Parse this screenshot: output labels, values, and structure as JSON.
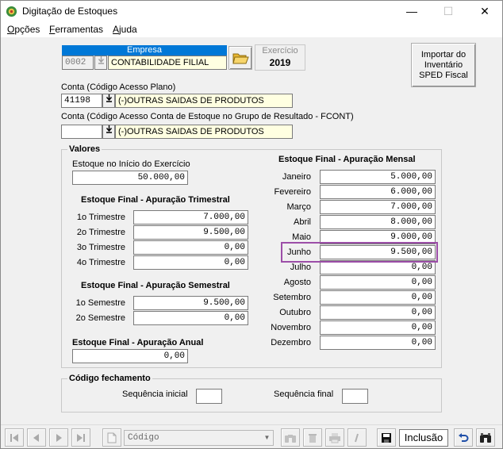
{
  "window": {
    "title": "Digitação de Estoques",
    "minimize": "—",
    "maximize": "☐",
    "close": "✕"
  },
  "menu": {
    "items": [
      {
        "prefix": "",
        "ul": "O",
        "rest": "pções"
      },
      {
        "prefix": "",
        "ul": "F",
        "rest": "erramentas"
      },
      {
        "prefix": "",
        "ul": "A",
        "rest": "juda"
      }
    ]
  },
  "empresa": {
    "header": "Empresa",
    "code": "0002",
    "name": "CONTABILIDADE FILIAL",
    "exercicio_label": "Exercício",
    "exercicio_value": "2019"
  },
  "importar_button": "Importar do Inventário SPED Fiscal",
  "conta": {
    "label": "Conta (Código Acesso Plano)",
    "code": "41198",
    "name": "(-)OUTRAS SAIDAS DE PRODUTOS"
  },
  "conta_fcont": {
    "label": "Conta (Código Acesso Conta de Estoque no Grupo de Resultado - FCONT)",
    "code": "",
    "name": "(-)OUTRAS SAIDAS DE PRODUTOS"
  },
  "valores": {
    "title": "Valores",
    "inicio_label": "Estoque no Início do Exercício",
    "inicio_value": "50.000,00",
    "trimestral": {
      "title": "Estoque Final - Apuração Trimestral",
      "rows": [
        {
          "label": "1o Trimestre",
          "value": "7.000,00"
        },
        {
          "label": "2o Trimestre",
          "value": "9.500,00"
        },
        {
          "label": "3o Trimestre",
          "value": "0,00"
        },
        {
          "label": "4o Trimestre",
          "value": "0,00"
        }
      ]
    },
    "semestral": {
      "title": "Estoque Final - Apuração Semestral",
      "rows": [
        {
          "label": "1o Semestre",
          "value": "9.500,00"
        },
        {
          "label": "2o Semestre",
          "value": "0,00"
        }
      ]
    },
    "anual": {
      "title": "Estoque Final - Apuração Anual",
      "value": "0,00"
    },
    "mensal": {
      "title": "Estoque Final - Apuração Mensal",
      "rows": [
        {
          "label": "Janeiro",
          "value": "5.000,00"
        },
        {
          "label": "Fevereiro",
          "value": "6.000,00"
        },
        {
          "label": "Março",
          "value": "7.000,00"
        },
        {
          "label": "Abril",
          "value": "8.000,00"
        },
        {
          "label": "Maio",
          "value": "9.000,00"
        },
        {
          "label": "Junho",
          "value": "9.500,00"
        },
        {
          "label": "Julho",
          "value": "0,00"
        },
        {
          "label": "Agosto",
          "value": "0,00"
        },
        {
          "label": "Setembro",
          "value": "0,00"
        },
        {
          "label": "Outubro",
          "value": "0,00"
        },
        {
          "label": "Novembro",
          "value": "0,00"
        },
        {
          "label": "Dezembro",
          "value": "0,00"
        }
      ]
    }
  },
  "fechamento": {
    "title": "Código fechamento",
    "seq_inicial_label": "Sequência inicial",
    "seq_inicial_value": "",
    "seq_final_label": "Sequência final",
    "seq_final_value": ""
  },
  "toolbar": {
    "search_placeholder": "Código",
    "mode": "Inclusão"
  },
  "colors": {
    "empresa_header": "#0078d7",
    "highlight": "#9c4ea8",
    "field_yellow": "#ffffe1"
  }
}
